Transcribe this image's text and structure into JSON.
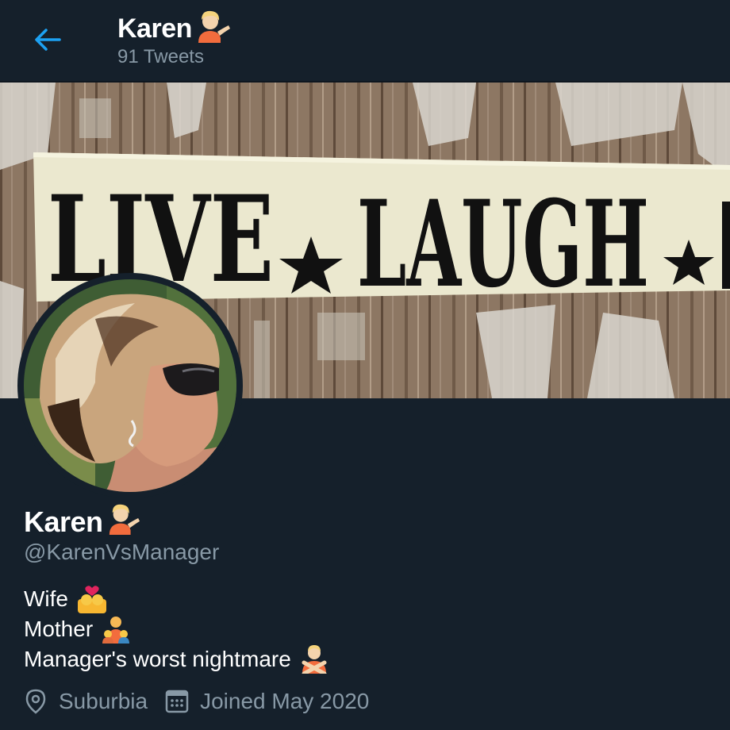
{
  "header": {
    "back_icon": "arrow-left-icon",
    "name": "Karen",
    "name_emoji": "person-tipping-hand-icon",
    "tweet_count": "91 Tweets"
  },
  "banner": {
    "sign_words": [
      "LIVE",
      "LAUGH"
    ]
  },
  "profile": {
    "name": "Karen",
    "name_emoji": "person-tipping-hand-icon",
    "handle": "@KarenVsManager",
    "bio": [
      {
        "text": "Wife",
        "emoji": "couple-kiss-icon"
      },
      {
        "text": "Mother",
        "emoji": "family-icon"
      },
      {
        "text": "Manager's worst nightmare",
        "emoji": "person-gesturing-no-icon"
      }
    ],
    "location": "Suburbia",
    "joined": "Joined May 2020"
  },
  "colors": {
    "background": "#15202b",
    "accent": "#1da1f2",
    "secondary_text": "#8899a6"
  }
}
